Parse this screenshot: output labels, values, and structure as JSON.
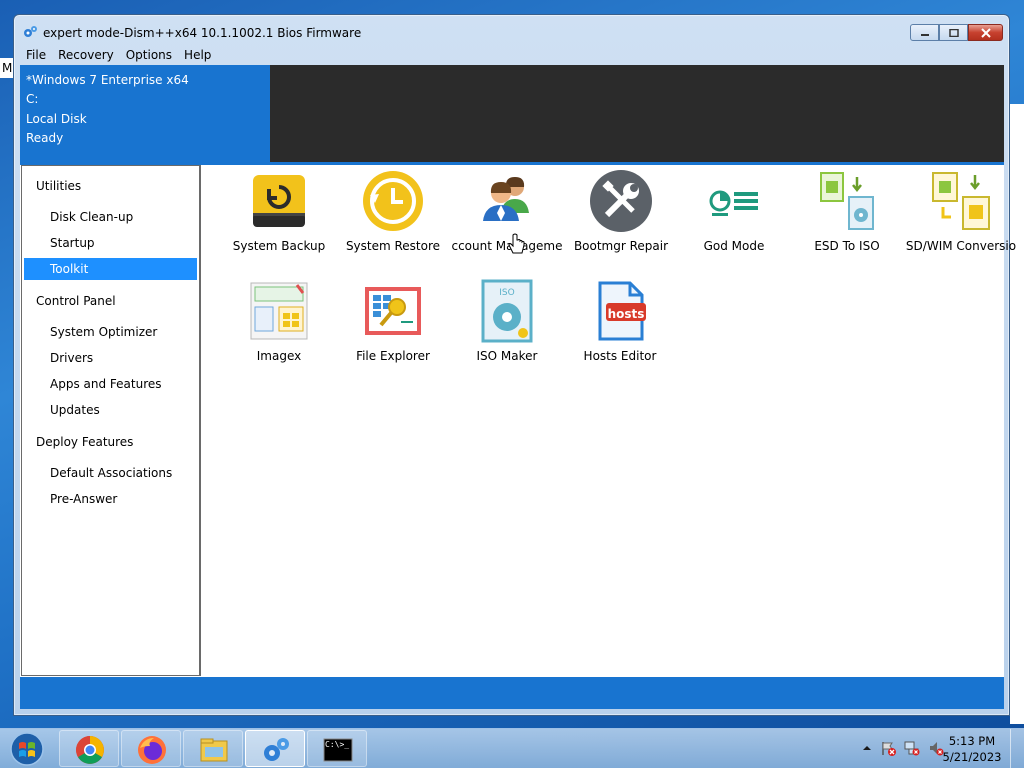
{
  "window": {
    "title": "expert mode-Dism++x64 10.1.1002.1 Bios Firmware",
    "controls": [
      "minimize",
      "maximize",
      "close"
    ]
  },
  "menu": {
    "items": [
      "File",
      "Recovery",
      "Options",
      "Help"
    ]
  },
  "image_info": {
    "name": "*Windows 7 Enterprise x64",
    "drive": "C:",
    "disk": "Local Disk",
    "status": "Ready"
  },
  "sidebar": {
    "sections": [
      {
        "title": "Utilities",
        "items": [
          "Disk Clean-up",
          "Startup",
          "Toolkit"
        ]
      },
      {
        "title": "Control Panel",
        "items": [
          "System Optimizer",
          "Drivers",
          "Apps and Features",
          "Updates"
        ]
      },
      {
        "title": "Deploy Features",
        "items": [
          "Default Associations",
          "Pre-Answer"
        ]
      }
    ],
    "selected": "Toolkit"
  },
  "tools": [
    {
      "label": "System Backup",
      "icon": "system-backup-icon"
    },
    {
      "label": "System Restore",
      "icon": "system-restore-icon"
    },
    {
      "label": "ccount Manageme",
      "icon": "account-management-icon"
    },
    {
      "label": "Bootmgr Repair",
      "icon": "bootmgr-repair-icon"
    },
    {
      "label": "God Mode",
      "icon": "god-mode-icon"
    },
    {
      "label": "ESD To ISO",
      "icon": "esd-to-iso-icon"
    },
    {
      "label": "SD/WIM Conversio",
      "icon": "esd-wim-conversion-icon"
    },
    {
      "label": "Imagex",
      "icon": "imagex-icon"
    },
    {
      "label": "File Explorer",
      "icon": "file-explorer-icon"
    },
    {
      "label": "ISO Maker",
      "icon": "iso-maker-icon"
    },
    {
      "label": "Hosts Editor",
      "icon": "hosts-editor-icon",
      "badge": "hosts"
    }
  ],
  "desktop": {
    "edge_letter": "M"
  },
  "taskbar": {
    "apps": [
      "chrome-icon",
      "firefox-icon",
      "explorer-icon",
      "dism-icon",
      "cmd-icon"
    ],
    "cmd_label": "C:\\>_",
    "time": "5:13 PM",
    "date": "5/21/2023"
  },
  "colors": {
    "accent": "#1874d0",
    "selection": "#1e90ff",
    "header_dark": "#2b2b2b"
  }
}
